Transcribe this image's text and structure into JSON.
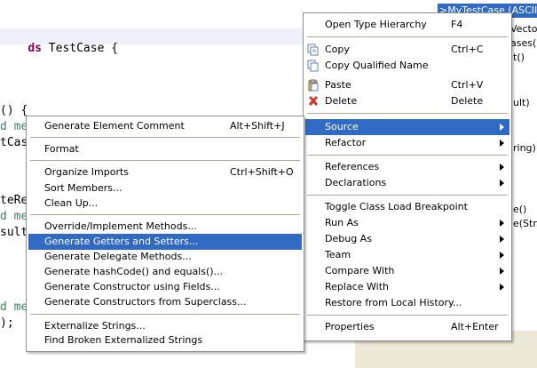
{
  "editor": {
    "line_keyword": "ds",
    "line_class": "TestCase {",
    "frag_paren": "() {",
    "frag_d_me": "d me",
    "frag_tcas": "tCas",
    "frag_tere": "teRe",
    "frag_d_me2": "d me",
    "frag_sult": "sult",
    "frag_d_me3": "d me",
    "frag_semi": ");"
  },
  "outline": {
    "selected_label": ">MyTestCase  (ASCII",
    "frag_vector": "Vector",
    "frag_ases": "ases()",
    "frag_t": "t()",
    "frag_ult": "ult)",
    "frag_ring": "ring)",
    "frag_e": "e()",
    "frag_strin": "e(Strin"
  },
  "main_menu": {
    "items": [
      {
        "label": "Open Type Hierarchy",
        "accel": "F4"
      },
      {
        "label": "Copy",
        "accel": "Ctrl+C",
        "icon": "copy-icon"
      },
      {
        "label": "Copy Qualified Name",
        "accel": "",
        "icon": "copy-qualified-icon"
      },
      {
        "label": "Paste",
        "accel": "Ctrl+V",
        "icon": "paste-icon"
      },
      {
        "label": "Delete",
        "accel": "Delete",
        "icon": "delete-icon"
      },
      {
        "label": "Source",
        "accel": ""
      },
      {
        "label": "Refactor",
        "accel": ""
      },
      {
        "label": "References",
        "accel": ""
      },
      {
        "label": "Declarations",
        "accel": ""
      },
      {
        "label": "Toggle Class Load Breakpoint",
        "accel": ""
      },
      {
        "label": "Run As",
        "accel": ""
      },
      {
        "label": "Debug As",
        "accel": ""
      },
      {
        "label": "Team",
        "accel": ""
      },
      {
        "label": "Compare With",
        "accel": ""
      },
      {
        "label": "Replace With",
        "accel": ""
      },
      {
        "label": "Restore from Local History...",
        "accel": ""
      },
      {
        "label": "Properties",
        "accel": "Alt+Enter"
      }
    ]
  },
  "source_menu": {
    "items": [
      {
        "label": "Generate Element Comment",
        "accel": "Alt+Shift+J"
      },
      {
        "label": "Format",
        "accel": ""
      },
      {
        "label": "Organize Imports",
        "accel": "Ctrl+Shift+O"
      },
      {
        "label": "Sort Members...",
        "accel": ""
      },
      {
        "label": "Clean Up...",
        "accel": ""
      },
      {
        "label": "Override/Implement Methods...",
        "accel": ""
      },
      {
        "label": "Generate Getters and Setters...",
        "accel": ""
      },
      {
        "label": "Generate Delegate Methods...",
        "accel": ""
      },
      {
        "label": "Generate hashCode() and equals()...",
        "accel": ""
      },
      {
        "label": "Generate Constructor using Fields...",
        "accel": ""
      },
      {
        "label": "Generate Constructors from Superclass...",
        "accel": ""
      },
      {
        "label": "Externalize Strings...",
        "accel": ""
      },
      {
        "label": "Find Broken Externalized Strings",
        "accel": ""
      }
    ]
  },
  "colors": {
    "highlight": "#316ac5",
    "keyword": "#7f0055",
    "delete_icon": "#d43a2a"
  }
}
